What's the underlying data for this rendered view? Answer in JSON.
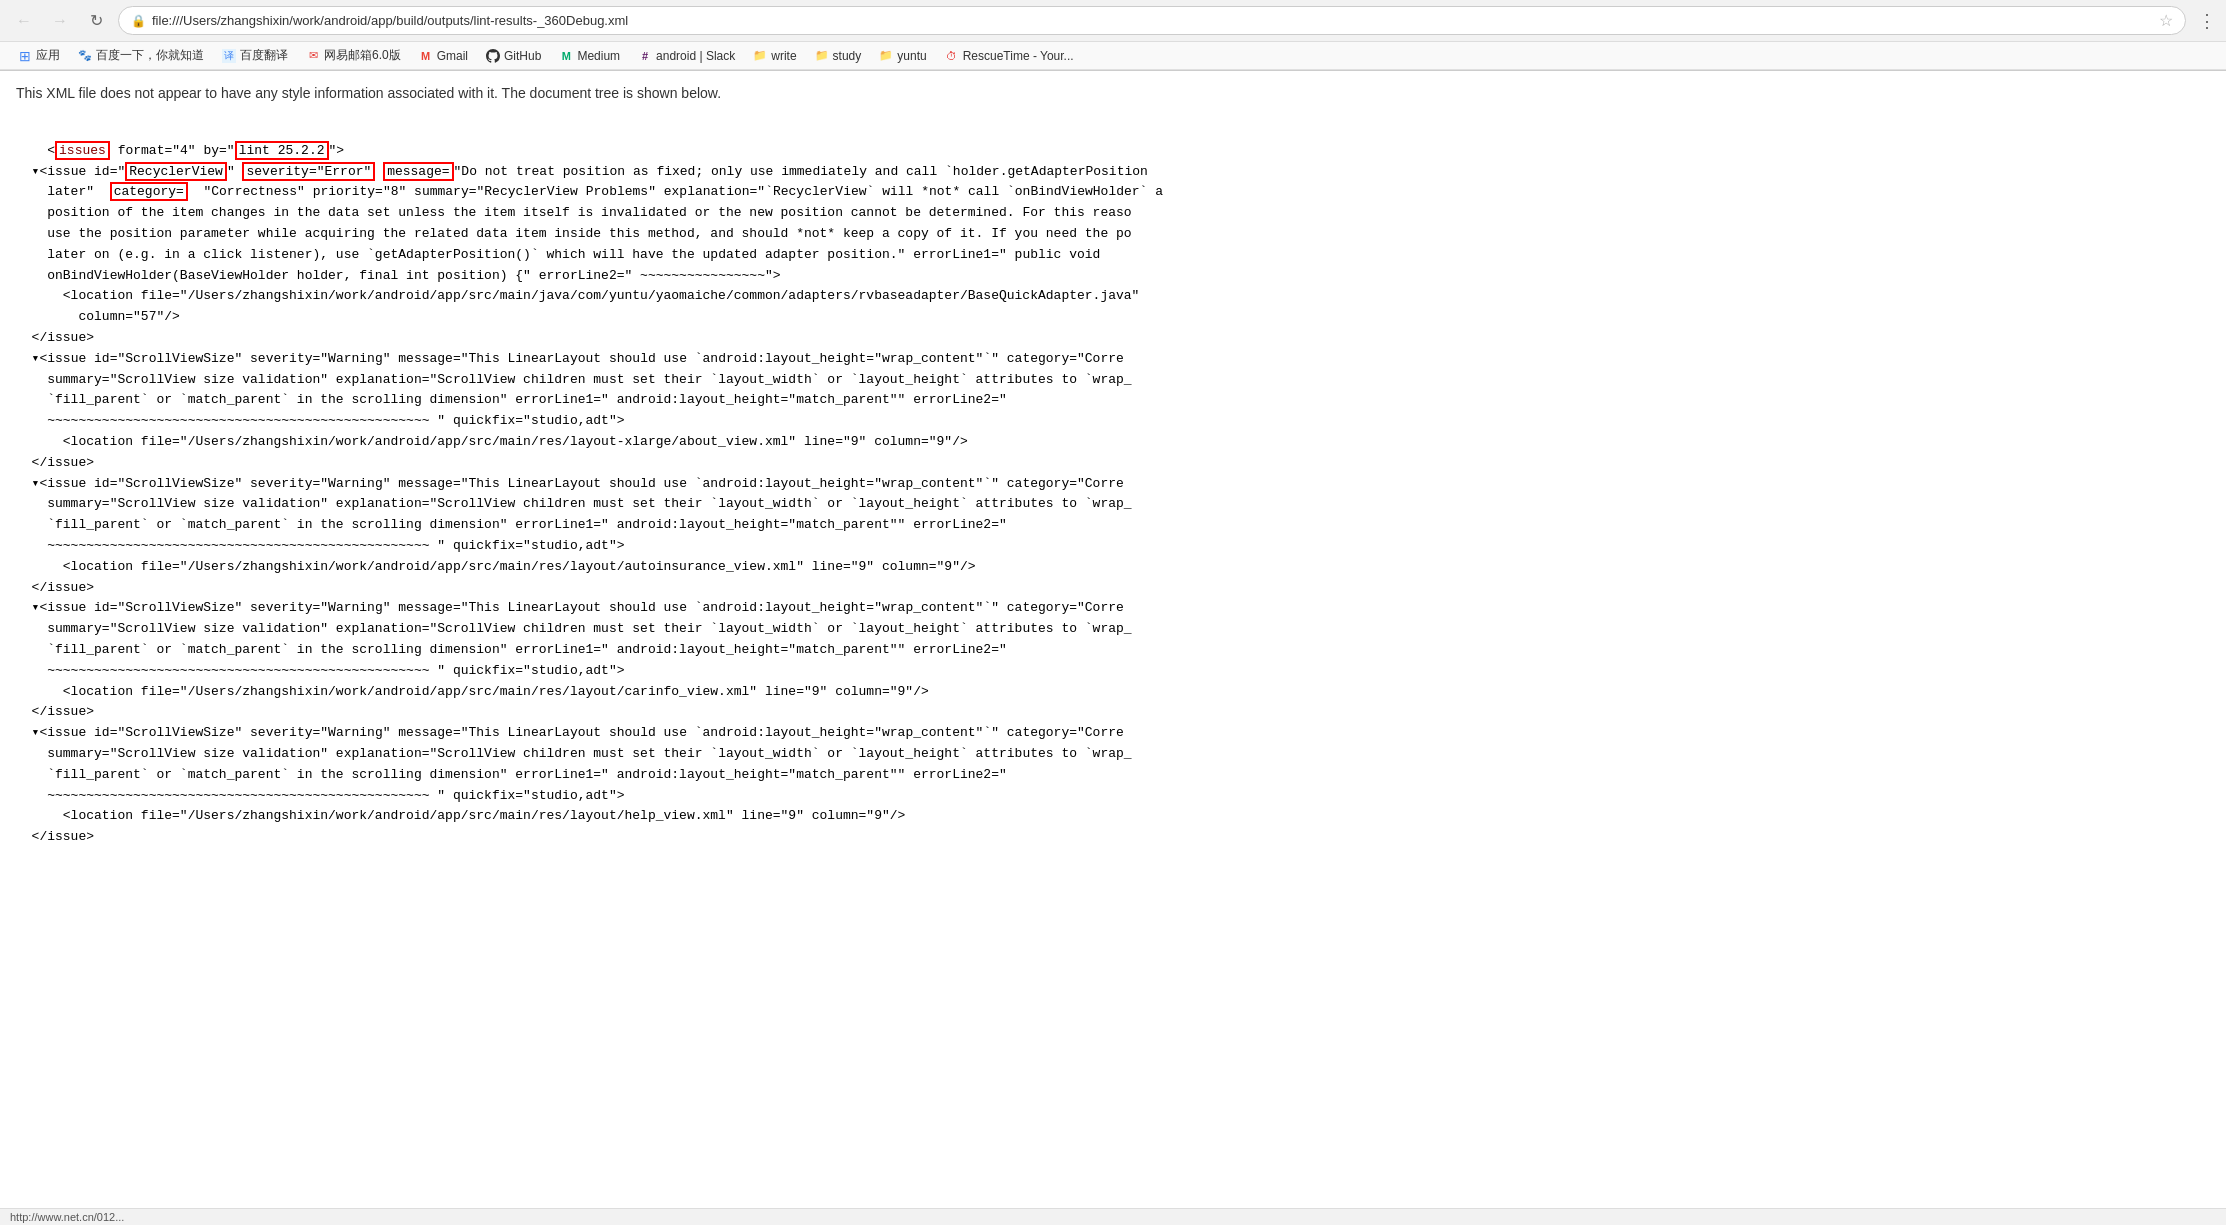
{
  "browser": {
    "address": "file:///Users/zhangshixin/work/android/app/build/outputs/lint-results-_360Debug.xml",
    "back_btn": "←",
    "forward_btn": "→",
    "refresh_btn": "↻"
  },
  "bookmarks": [
    {
      "label": "应用",
      "icon": "⊞",
      "color": "#4285F4"
    },
    {
      "label": "百度一下，你就知道",
      "icon": "🐾",
      "color": "#2196F3"
    },
    {
      "label": "百度翻译",
      "icon": "译",
      "color": "#4285F4"
    },
    {
      "label": "网易邮箱6.0版",
      "icon": "✉",
      "color": "#e53935"
    },
    {
      "label": "Gmail",
      "icon": "M",
      "color": "#EA4335"
    },
    {
      "label": "GitHub",
      "icon": "⊙",
      "color": "#333"
    },
    {
      "label": "Medium",
      "icon": "M",
      "color": "#00ab6c"
    },
    {
      "label": "android | Slack",
      "icon": "#",
      "color": "#611f69"
    },
    {
      "label": "write",
      "icon": "📁",
      "color": "#795548"
    },
    {
      "label": "study",
      "icon": "📁",
      "color": "#795548"
    },
    {
      "label": "yuntu",
      "icon": "📁",
      "color": "#795548"
    },
    {
      "label": "RescueTime - Your...",
      "icon": "⏱",
      "color": "#e53935"
    }
  ],
  "info_message": "This XML file does not appear to have any style information associated with it. The document tree is shown below.",
  "xml": {
    "header": "<issues format=\"4\" by=\"lint 25.2.2\">",
    "issues": [
      {
        "opening": "▾<issue id=\"RecyclerView\" severity=\"Error\" message=\"Do not treat position as fixed; only use immediately and call `holder.getAdapterPosition",
        "continuation1": "later\"  category=  \"Correctness\" priority=\"8\" summary=\"RecyclerView Problems\" explanation=\"`RecyclerView` will *not* call `onBindViewHolder` a",
        "continuation2": "position of the item changes in the data set unless the item itself is invalidated or the new position cannot be determined. For this reaso",
        "continuation3": "use the position parameter while acquiring the related data item inside this method, and should *not* keep a copy of it. If you need the po",
        "continuation4": "later on (e.g. in a click listener), use `getAdapterPosition()` which will have the updated adapter position.\" errorLine1=\" public void",
        "continuation5": "onBindViewHolder(BaseViewHolder holder, final int position) {\" errorLine2=\" ~~~~~~~~~~~~~~~~\">",
        "location": "    <location file=\"/Users/zhangshixin/work/android/app/src/main/java/com/yuntu/yaomaiche/common/adapters/rvbaseadapter/BaseQuickAdapter.java\"",
        "column": "      column=\"57\"/>",
        "closing": "  </issue>"
      },
      {
        "opening": "▾<issue id=\"ScrollViewSize\" severity=\"Warning\" message=\"This LinearLayout should use `android:layout_height=\"wrap_content\"`\" category=\"Corre",
        "continuation1": "summary=\"ScrollView size validation\" explanation=\"ScrollView children must set their `layout_width` or `layout_height` attributes to `wrap_",
        "continuation2": "`fill_parent` or `match_parent` in the scrolling dimension\" errorLine1=\" android:layout_height=\"match_parent\"\" errorLine2=\"",
        "continuation3": "~~~~~~~~~~~~~~~~~~~~~~~~~~~~~~~~~~~~~~~~~~~~~~~~~ \" quickfix=\"studio,adt\">",
        "location": "    <location file=\"/Users/zhangshixin/work/android/app/src/main/res/layout-xlarge/about_view.xml\" line=\"9\" column=\"9\"/>",
        "closing": "  </issue>"
      },
      {
        "opening": "▾<issue id=\"ScrollViewSize\" severity=\"Warning\" message=\"This LinearLayout should use `android:layout_height=\"wrap_content\"`\" category=\"Corre",
        "continuation1": "summary=\"ScrollView size validation\" explanation=\"ScrollView children must set their `layout_width` or `layout_height` attributes to `wrap_",
        "continuation2": "`fill_parent` or `match_parent` in the scrolling dimension\" errorLine1=\" android:layout_height=\"match_parent\"\" errorLine2=\"",
        "continuation3": "~~~~~~~~~~~~~~~~~~~~~~~~~~~~~~~~~~~~~~~~~~~~~~~~~ \" quickfix=\"studio,adt\">",
        "location": "    <location file=\"/Users/zhangshixin/work/android/app/src/main/res/layout/autoinsurance_view.xml\" line=\"9\" column=\"9\"/>",
        "closing": "  </issue>"
      },
      {
        "opening": "▾<issue id=\"ScrollViewSize\" severity=\"Warning\" message=\"This LinearLayout should use `android:layout_height=\"wrap_content\"`\" category=\"Corre",
        "continuation1": "summary=\"ScrollView size validation\" explanation=\"ScrollView children must set their `layout_width` or `layout_height` attributes to `wrap_",
        "continuation2": "`fill_parent` or `match_parent` in the scrolling dimension\" errorLine1=\" android:layout_height=\"match_parent\"\" errorLine2=\"",
        "continuation3": "~~~~~~~~~~~~~~~~~~~~~~~~~~~~~~~~~~~~~~~~~~~~~~~~~ \" quickfix=\"studio,adt\">",
        "location": "    <location file=\"/Users/zhangshixin/work/android/app/src/main/res/layout/carinfo_view.xml\" line=\"9\" column=\"9\"/>",
        "closing": "  </issue>"
      },
      {
        "opening": "▾<issue id=\"ScrollViewSize\" severity=\"Warning\" message=\"This LinearLayout should use `android:layout_height=\"wrap_content\"`\" category=\"Corre",
        "continuation1": "summary=\"ScrollView size validation\" explanation=\"ScrollView children must set their `layout_width` or `layout_height` attributes to `wrap_",
        "continuation2": "`fill_parent` or `match_parent` in the scrolling dimension\" errorLine1=\" android:layout_height=\"match_parent\"\" errorLine2=\"",
        "continuation3": "~~~~~~~~~~~~~~~~~~~~~~~~~~~~~~~~~~~~~~~~~~~~~~~~~ \" quickfix=\"studio,adt\">",
        "location": "    <location file=\"/Users/zhangshixin/work/android/app/src/main/res/layout/help_view.xml\" line=\"9\" column=\"9\"/>",
        "closing": "  </issue>"
      }
    ]
  },
  "status_bar": {
    "url": "http://www.net.cn/012..."
  },
  "icons": {
    "back": "←",
    "forward": "→",
    "refresh": "↻",
    "lock": "🔒",
    "star": "☆",
    "menu": "⋮",
    "grid": "⊞",
    "folder": "📁"
  }
}
